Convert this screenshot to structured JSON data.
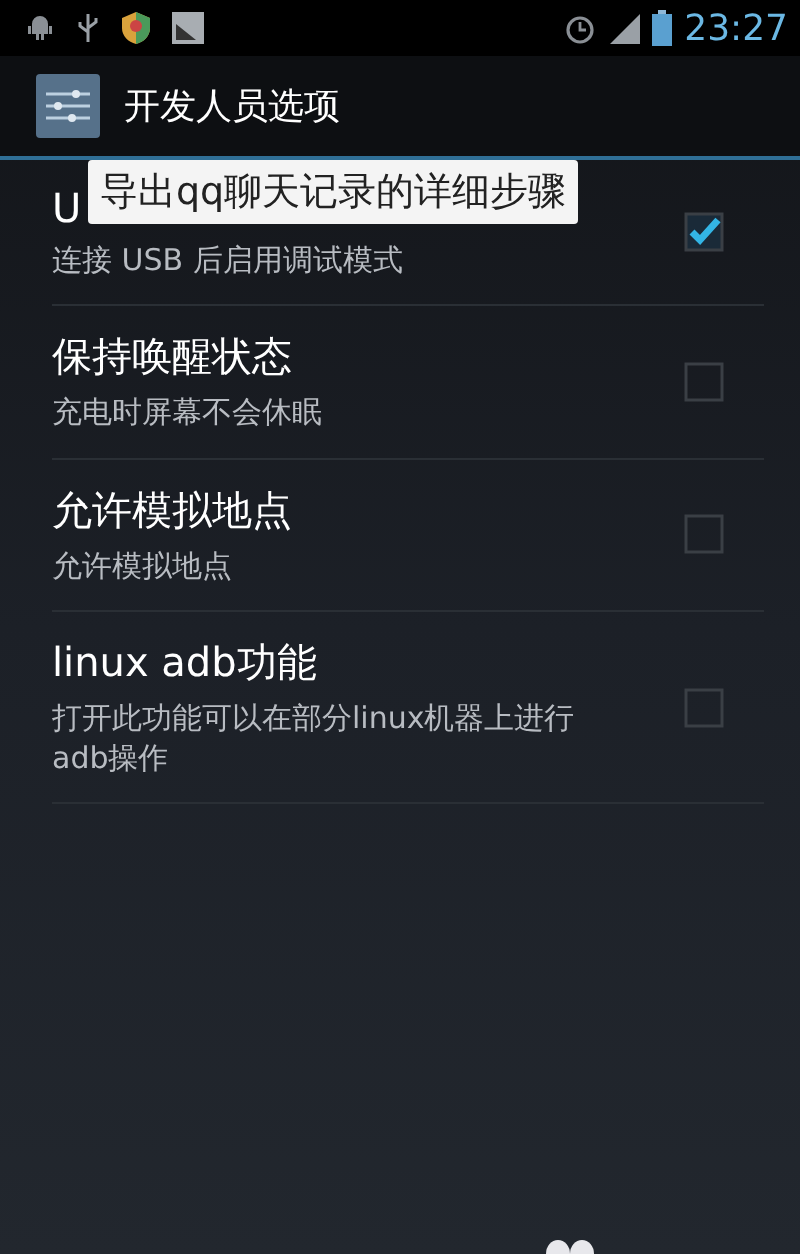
{
  "status_bar": {
    "time": "23:27"
  },
  "action_bar": {
    "title": "开发人员选项"
  },
  "tooltip": {
    "text": "导出qq聊天记录的详细步骤"
  },
  "settings": [
    {
      "title": "U",
      "summary": "连接 USB 后启用调试模式",
      "checked": true
    },
    {
      "title": "保持唤醒状态",
      "summary": "充电时屏幕不会休眠",
      "checked": false
    },
    {
      "title": "允许模拟地点",
      "summary": "允许模拟地点",
      "checked": false
    },
    {
      "title": "linux adb功能",
      "summary": "打开此功能可以在部分linux机器上进行adb操作",
      "checked": false
    }
  ]
}
